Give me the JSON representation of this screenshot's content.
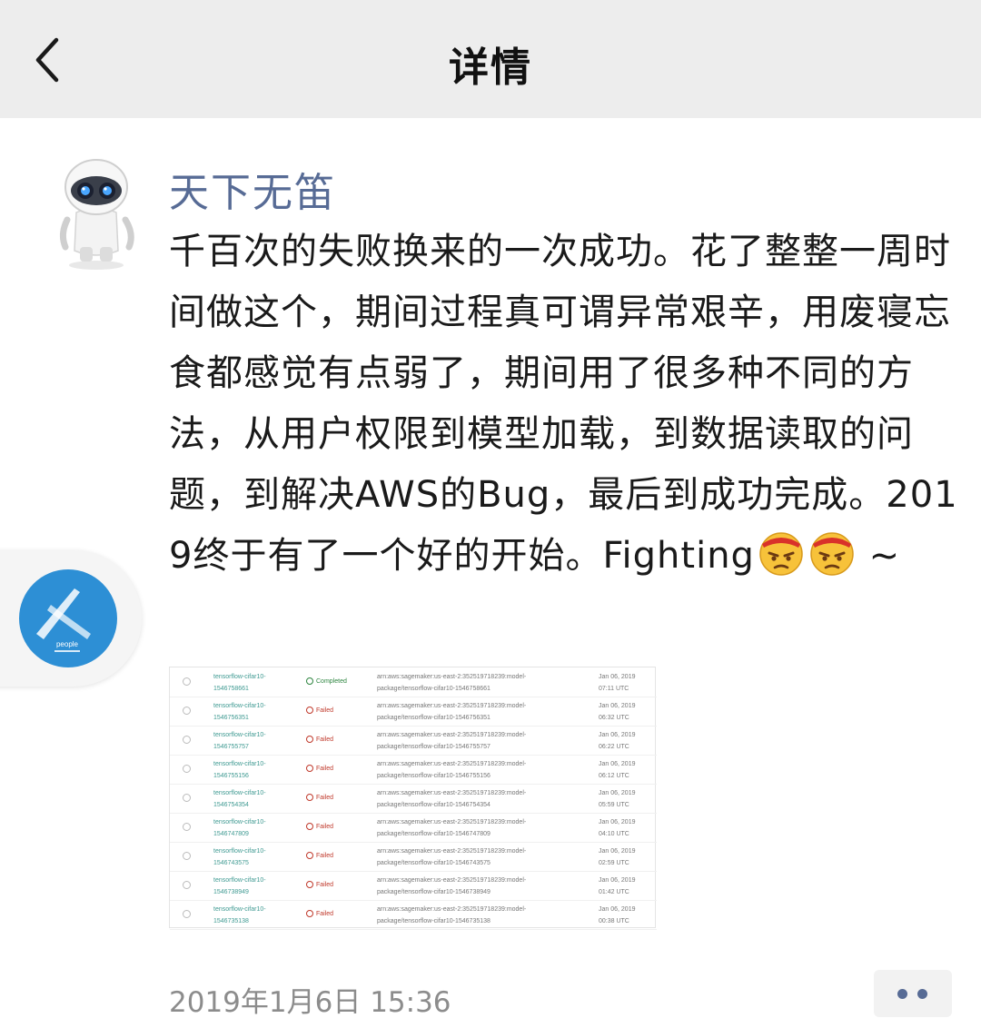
{
  "header": {
    "title": "详情"
  },
  "post": {
    "author": "天下无笛",
    "text_main": "千百次的失败换来的一次成功。花了整整一周时间做这个，期间过程真可谓异常艰辛，用废寝忘食都感觉有点弱了，期间用了很多种不同的方法，从用户权限到模型加载，到数据读取的问题，到解决AWS的Bug，最后到成功完成。2019终于有了一个好的开始。Fighting",
    "text_tail": " ~",
    "emoji_icons": [
      "angry-face-emoji",
      "angry-face-emoji"
    ],
    "timestamp": "2019年1月6日 15:36"
  },
  "floating_app": {
    "label": "people"
  },
  "screenshot_table": {
    "rows": [
      {
        "job": [
          "tensorflow-cifar10-",
          "1546758661"
        ],
        "status": "Completed",
        "arn": [
          "arn:aws:sagemaker:us-east-2:352519718239:model-",
          "package/tensorflow-cifar10-1546758661"
        ],
        "date": [
          "Jan 06, 2019",
          "07:11 UTC"
        ]
      },
      {
        "job": [
          "tensorflow-cifar10-",
          "1546756351"
        ],
        "status": "Failed",
        "arn": [
          "arn:aws:sagemaker:us-east-2:352519718239:model-",
          "package/tensorflow-cifar10-1546756351"
        ],
        "date": [
          "Jan 06, 2019",
          "06:32 UTC"
        ]
      },
      {
        "job": [
          "tensorflow-cifar10-",
          "1546755757"
        ],
        "status": "Failed",
        "arn": [
          "arn:aws:sagemaker:us-east-2:352519718239:model-",
          "package/tensorflow-cifar10-1546755757"
        ],
        "date": [
          "Jan 06, 2019",
          "06:22 UTC"
        ]
      },
      {
        "job": [
          "tensorflow-cifar10-",
          "1546755156"
        ],
        "status": "Failed",
        "arn": [
          "arn:aws:sagemaker:us-east-2:352519718239:model-",
          "package/tensorflow-cifar10-1546755156"
        ],
        "date": [
          "Jan 06, 2019",
          "06:12 UTC"
        ]
      },
      {
        "job": [
          "tensorflow-cifar10-",
          "1546754354"
        ],
        "status": "Failed",
        "arn": [
          "arn:aws:sagemaker:us-east-2:352519718239:model-",
          "package/tensorflow-cifar10-1546754354"
        ],
        "date": [
          "Jan 06, 2019",
          "05:59 UTC"
        ]
      },
      {
        "job": [
          "tensorflow-cifar10-",
          "1546747809"
        ],
        "status": "Failed",
        "arn": [
          "arn:aws:sagemaker:us-east-2:352519718239:model-",
          "package/tensorflow-cifar10-1546747809"
        ],
        "date": [
          "Jan 06, 2019",
          "04:10 UTC"
        ]
      },
      {
        "job": [
          "tensorflow-cifar10-",
          "1546743575"
        ],
        "status": "Failed",
        "arn": [
          "arn:aws:sagemaker:us-east-2:352519718239:model-",
          "package/tensorflow-cifar10-1546743575"
        ],
        "date": [
          "Jan 06, 2019",
          "02:59 UTC"
        ]
      },
      {
        "job": [
          "tensorflow-cifar10-",
          "1546738949"
        ],
        "status": "Failed",
        "arn": [
          "arn:aws:sagemaker:us-east-2:352519718239:model-",
          "package/tensorflow-cifar10-1546738949"
        ],
        "date": [
          "Jan 06, 2019",
          "01:42 UTC"
        ]
      },
      {
        "job": [
          "tensorflow-cifar10-",
          "1546735138"
        ],
        "status": "Failed",
        "arn": [
          "arn:aws:sagemaker:us-east-2:352519718239:model-",
          "package/tensorflow-cifar10-1546735138"
        ],
        "date": [
          "Jan 06, 2019",
          "00:38 UTC"
        ]
      }
    ]
  },
  "colors": {
    "link_blue": "#576b95",
    "header_bg": "#ededed",
    "timestamp_gray": "#8c8c8c"
  }
}
